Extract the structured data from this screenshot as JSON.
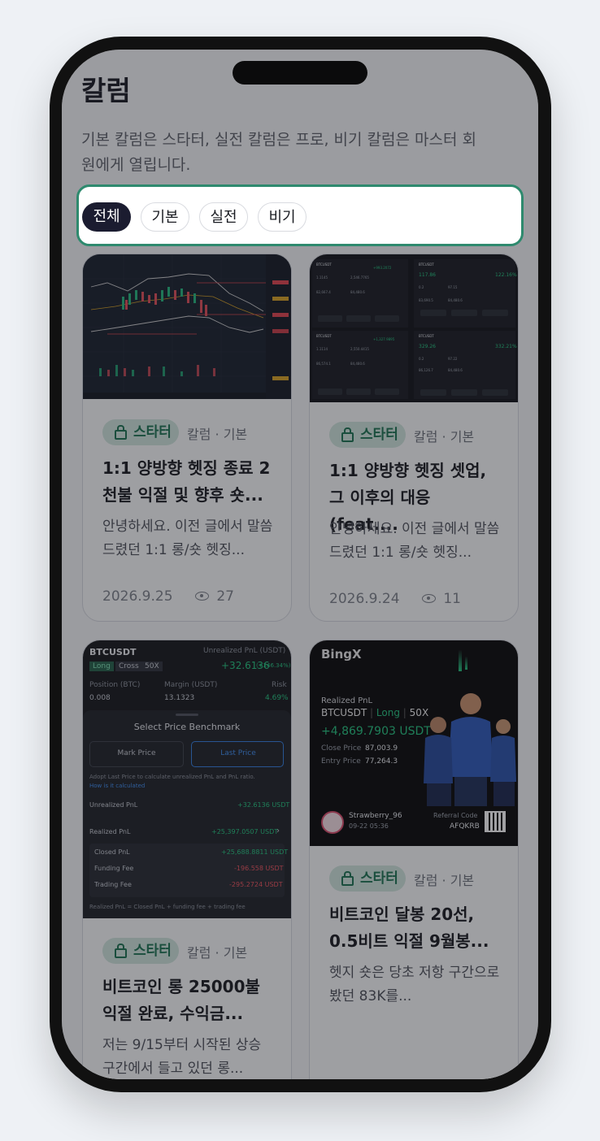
{
  "page": {
    "title": "칼럼",
    "description": "기본 칼럼은 스타터, 실전 칼럼은 프로, 비기 칼럼은 마스터 회원에게 열립니다."
  },
  "filters": [
    {
      "label": "전체",
      "active": true
    },
    {
      "label": "기본",
      "active": false
    },
    {
      "label": "실전",
      "active": false
    },
    {
      "label": "비기",
      "active": false
    }
  ],
  "columns": [
    {
      "badge": "스타터",
      "meta": "칼럼 · 기본",
      "title": "1:1 양방향 헷징 종료 2천불 익절 및 향후 숏...",
      "excerpt": "안녕하세요. 이전 글에서 말씀드렸던 1:1 롱/숏 헷징...",
      "date": "2026.9.25",
      "views": "27"
    },
    {
      "badge": "스타터",
      "meta": "칼럼 · 기본",
      "title": "1:1 양방향 헷징 셋업, 그 이후의 대응 (feat....",
      "excerpt": "안녕하세요. 이전 글에서 말씀드렸던 1:1 롱/숏 헷징...",
      "date": "2026.9.24",
      "views": "11"
    },
    {
      "badge": "스타터",
      "meta": "칼럼 · 기본",
      "title": "비트코인 롱 25000불 익절 완료, 수익금...",
      "excerpt": "저는 9/15부터 시작된 상승 구간에서 들고 있던 롱...",
      "thumb": {
        "pair": "BTCUSDT",
        "unrealized_label": "Unrealized PnL (USDT)",
        "side": "Long",
        "mode": "Cross",
        "leverage": "50X",
        "pnl": "+32.6136",
        "pnl_pct": "(+246.34%)",
        "position_label": "Position (BTC)",
        "position": "0.008",
        "margin_label": "Margin (USDT)",
        "margin": "13.1323",
        "risk_label": "Risk",
        "risk": "4.69%",
        "sheet_title": "Select Price Benchmark",
        "mark_price": "Mark Price",
        "last_price": "Last Price",
        "note": "Adopt Last Price to calculate unrealized PnL and PnL ratio.",
        "note_link": "How is it calculated",
        "rows": [
          {
            "label": "Unrealized PnL",
            "value": "+32.6136 USDT",
            "color": "#1fc37c"
          },
          {
            "label": "Realized PnL",
            "value": "+25,397.0507 USDT",
            "color": "#1fc37c"
          },
          {
            "label": "Closed PnL",
            "value": "+25,688.8811 USDT",
            "color": "#1fc37c"
          },
          {
            "label": "Funding Fee",
            "value": "-196.558 USDT",
            "color": "#f0505a"
          },
          {
            "label": "Trading Fee",
            "value": "-295.2724 USDT",
            "color": "#f0505a"
          }
        ],
        "formula": "Realized PnL = Closed PnL + funding fee + trading fee"
      }
    },
    {
      "badge": "스타터",
      "meta": "칼럼 · 기본",
      "title": "비트코인 달봉 20선, 0.5비트 익절 9월봉...",
      "excerpt": "헷지 숏은 당초 저항 구간으로 봤던 83K를...",
      "thumb": {
        "brand": "BingX",
        "realized_label": "Realized PnL",
        "pair": "BTCUSDT",
        "side": "Long",
        "leverage": "50X",
        "pnl": "+4,869.7903 USDT",
        "close_label": "Close Price",
        "close_price": "87,003.9",
        "entry_label": "Entry Price",
        "entry_price": "77,264.3",
        "user": "Strawberry_96",
        "user_date": "09-22 05:36",
        "ref_label": "Referral Code",
        "ref_code": "AFQKRB"
      }
    }
  ],
  "colors": {
    "accent": "#2e8a6e",
    "badge_bg": "#cfe6dc",
    "badge_text": "#17704f",
    "active_chip": "#1b1c30"
  }
}
